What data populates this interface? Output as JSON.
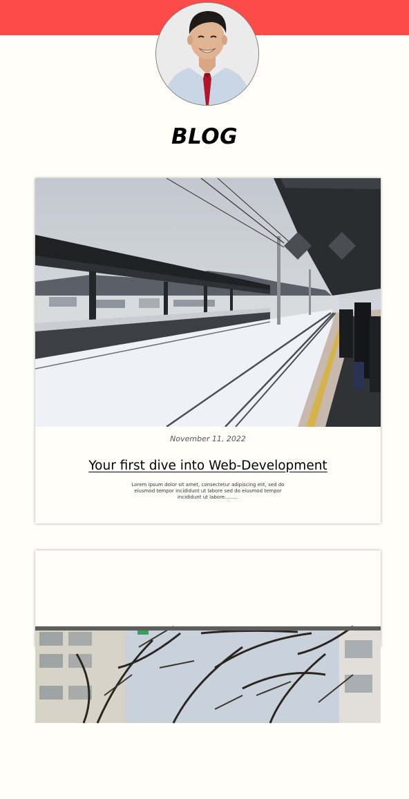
{
  "header": {
    "accent_color": "#fe4a49",
    "avatar_icon": "profile-photo"
  },
  "page": {
    "title": "BLOG"
  },
  "posts": [
    {
      "image": "snowy-train-station-photo",
      "date": "November 11, 2022",
      "title": "Your first dive into Web-Development",
      "excerpt": "Lorem ipsum dolor sit amet, consectetur adipiscing elit, sed do eiusmod tempor incididunt ut labore sed do eiusmod tempor incididunt ut labore........."
    },
    {
      "image": "cherry-trees-street-photo"
    }
  ]
}
